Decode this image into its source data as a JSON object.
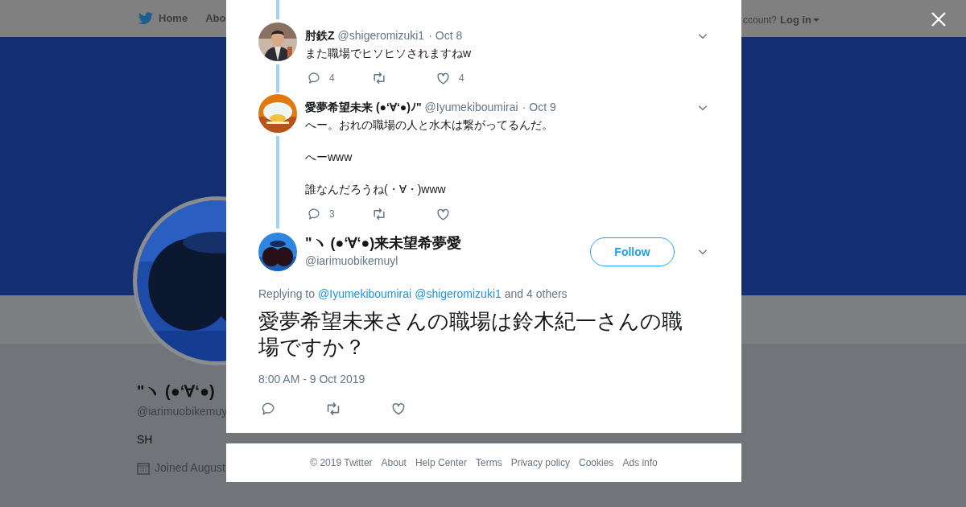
{
  "nav": {
    "items": [
      {
        "label": "Home",
        "kind": "home"
      },
      {
        "label": "Abo",
        "kind": "plain"
      }
    ],
    "account_prompt": "ccount?",
    "login": "Log in"
  },
  "profile": {
    "name": "\"ヽ (●‘∀‘●)",
    "handle": "@iarimuobikemuy",
    "bio": "SH",
    "joined": "Joined August"
  },
  "thread": [
    {
      "name": "肘鉄Z",
      "handle": "@shigeromizuki1",
      "dot": "·",
      "date": "Oct 8",
      "lines": [
        "また職場でヒソヒソされますねw"
      ],
      "replies": "4",
      "likes": "4"
    },
    {
      "name": "愛夢希望未来 (●‘∀‘●)ﾉ\"",
      "handle": "@Iyumekiboumirai",
      "dot": "·",
      "date": "Oct 9",
      "lines": [
        "へー。おれの職場の人と水木は繋がってるんだ。",
        "へーwww",
        "誰なんだろうね(・∀・)www"
      ],
      "replies": "3"
    }
  ],
  "main_tweet": {
    "name": "\"ヽ (●‘∀‘●)来未望希夢愛",
    "handle": "@iarimuobikemuyl",
    "follow": "Follow",
    "replying_label": "Replying to",
    "mentions": [
      "@Iyumekiboumirai",
      "@shigeromizuki1"
    ],
    "others": "and 4 others",
    "text": "愛夢希望未来さんの職場は鈴木紀一さんの職場ですか？",
    "time": "8:00 AM - 9 Oct 2019"
  },
  "footer": {
    "links": [
      "© 2019 Twitter",
      "About",
      "Help Center",
      "Terms",
      "Privacy policy",
      "Cookies",
      "Ads info"
    ]
  }
}
